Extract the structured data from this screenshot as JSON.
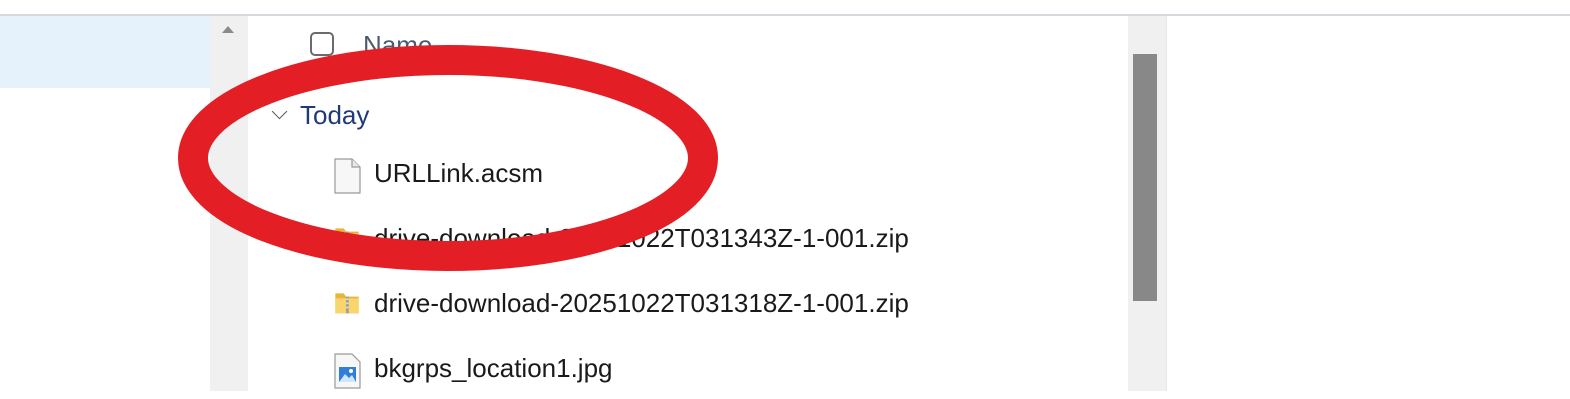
{
  "header": {
    "name_column": "Name",
    "select_all_checkbox_checked": false
  },
  "group": {
    "label": "Today",
    "expanded": true
  },
  "files": [
    {
      "name": "URLLink.acsm",
      "icon": "generic-file-icon"
    },
    {
      "name": "drive-download-20251022T031343Z-1-001.zip",
      "icon": "zip-folder-icon"
    },
    {
      "name": "drive-download-20251022T031318Z-1-001.zip",
      "icon": "zip-folder-icon"
    },
    {
      "name": "bkgrps_location1.jpg",
      "icon": "image-file-icon"
    }
  ],
  "annotation": {
    "shape": "ellipse",
    "color": "#e31e24",
    "highlights": "URLLink.acsm"
  },
  "colors": {
    "nav_selected": "#e5f1fb",
    "group_label": "#1f3a78",
    "scroll_thumb": "#888888"
  }
}
